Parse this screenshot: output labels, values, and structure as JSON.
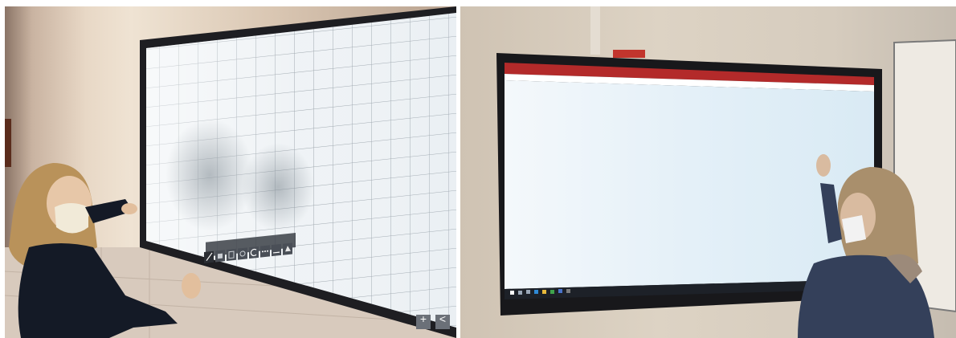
{
  "left_photo": {
    "whiteboard_toolbar": {
      "tools": [
        {
          "icon": "pen-icon"
        },
        {
          "icon": "eraser-icon"
        },
        {
          "icon": "select-icon"
        },
        {
          "icon": "shape-icon"
        },
        {
          "icon": "undo-icon"
        },
        {
          "icon": "more-icon"
        },
        {
          "icon": "line-icon"
        },
        {
          "icon": "clear-icon"
        }
      ],
      "page_controls": {
        "add_icon": "plus-icon",
        "prev_icon": "chevron-left-icon"
      },
      "add_label": "+",
      "prev_label": "<"
    }
  },
  "right_photo": {
    "browser": {
      "accent": "#b32a2a",
      "tab_icon": "browser-tab-icon",
      "screen_background": "#e6f1f8"
    },
    "taskbar": {
      "icons": [
        "start-icon",
        "search-icon",
        "taskview-icon",
        "edge-icon",
        "explorer-icon",
        "chrome-icon",
        "app-icon",
        "app-icon"
      ]
    }
  },
  "colors": {
    "board_bezel": "#1e1e22",
    "grid_line": "#9aa3ab",
    "board_surface": "#e9eef2",
    "sweater_left": "#141a26",
    "jacket_right": "#34405a"
  }
}
